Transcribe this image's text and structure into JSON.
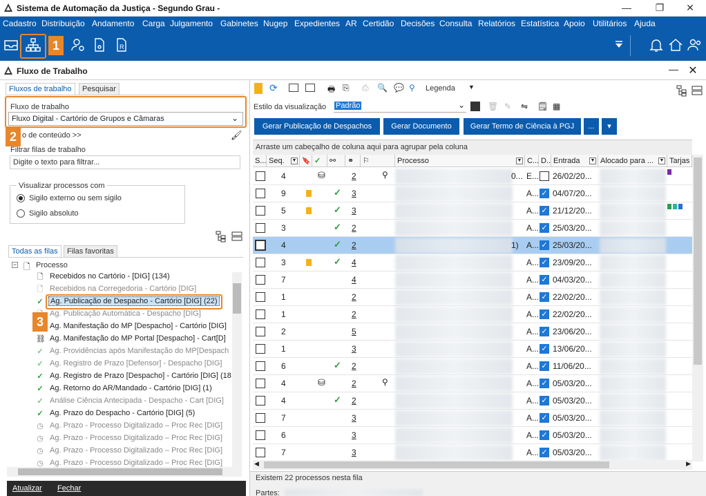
{
  "app": {
    "title": "Sistema de Automação da Justiça - Segundo Grau -",
    "win_min": "—",
    "win_max": "❐",
    "win_close": "✕"
  },
  "menu": [
    "Cadastro",
    "Distribuição",
    "Andamento",
    "Carga",
    "Julgamento",
    "Gabinetes",
    "Nugep",
    "Expedientes",
    "AR",
    "Certidão",
    "Decisões",
    "Consulta",
    "Relatórios",
    "Estatística",
    "Apoio",
    "Utilitários",
    "Ajuda"
  ],
  "callouts": {
    "one": "1",
    "two": "2",
    "three": "3"
  },
  "panel": {
    "title": "Fluxo de Trabalho",
    "close": "✕"
  },
  "left": {
    "tabs": [
      "Fluxos de trabalho",
      "Pesquisar"
    ],
    "flow_label": "Fluxo de trabalho",
    "flow_value": "Fluxo Digital - Cartório de Grupos e Câmaras",
    "content_link": "o de conteúdo >>",
    "filter_label": "Filtrar filas de trabalho",
    "filter_placeholder": "Digite o texto para filtrar...",
    "view_group": "Visualizar processos com",
    "radio1": "Sigilo externo ou sem sigilo",
    "radio2": "Sigilo absoluto",
    "queue_tabs": [
      "Todas as filas",
      "Filas favoritas"
    ],
    "root": "Processo",
    "items": [
      {
        "icon": "doc",
        "text": "Recebidos no Cartório - [DIG] (134)",
        "gray": false
      },
      {
        "icon": "doc",
        "text": "Recebidos na Corregedoria - Cartório [DIG]",
        "gray": true
      },
      {
        "icon": "check",
        "text": "Ag. Publicação de Despacho - Cartório [DIG] (22)",
        "gray": false,
        "sel": true
      },
      {
        "icon": "doc",
        "text": "Ag. Publicação Automática - Despacho [DIG]",
        "gray": true
      },
      {
        "icon": "doc",
        "text": "Ag. Manifestação do MP [Despacho] - Cartório [DIG]",
        "gray": false
      },
      {
        "icon": "share",
        "text": "Ag. Manifestação do MP Portal [Despacho] - Cart[D]",
        "gray": false
      },
      {
        "icon": "check",
        "text": "Ag. Providências após Manifestação do MP[Despach",
        "gray": true
      },
      {
        "icon": "check",
        "text": "Ag. Registro de Prazo [Defensor] - Despacho [DIG]",
        "gray": true
      },
      {
        "icon": "check",
        "text": "Ag. Registro de Prazo [Despacho] - Cartório [DIG] (18",
        "gray": false
      },
      {
        "icon": "check",
        "text": "Ag. Retorno do AR/Mandado - Cartório [DIG] (1)",
        "gray": false
      },
      {
        "icon": "check",
        "text": "Análise Ciência Antecipada - Despacho - Cart [DIG]",
        "gray": true
      },
      {
        "icon": "check",
        "text": "Ag. Prazo do Despacho - Cartório [DIG] (5)",
        "gray": false
      },
      {
        "icon": "clock",
        "text": "Ag. Prazo - Processo Digitalizado – Proc Rec [DIG]",
        "gray": true
      },
      {
        "icon": "clock",
        "text": "Ag. Prazo - Processo Digitalizado – Proc Rec [DIG]",
        "gray": true
      },
      {
        "icon": "clock",
        "text": "Ag. Prazo - Processo Digitalizado – Proc Rec [DIG]",
        "gray": true
      },
      {
        "icon": "clock",
        "text": "Ag. Prazo - Processo Digitalizado – Proc Rec [DIG]",
        "gray": true
      }
    ],
    "footer_update": "Atualizar",
    "footer_close": "Fechar"
  },
  "right": {
    "legend_label": "Legenda",
    "style_label": "Estilo da visualização",
    "style_value": "Padrão",
    "buttons": [
      "Gerar Publicação de Despachos",
      "Gerar Documento",
      "Gerar Termo de Ciência à PGJ",
      "..."
    ],
    "group_hint": "Arraste um cabeçalho de coluna aqui para agrupar pela coluna",
    "columns": [
      "S...",
      "Seq.",
      "",
      "",
      "",
      "",
      "",
      "Processo",
      "C...",
      "D...",
      "Entrada",
      "Alocado para ...",
      "Tarjas"
    ],
    "rows": [
      {
        "seq": "4",
        "flag": false,
        "check": false,
        "doc": true,
        "n": "2",
        "pin": true,
        "c": "E...",
        "d": false,
        "date": "26/02/20...",
        "pre": "0..."
      },
      {
        "seq": "9",
        "flag": true,
        "check": true,
        "doc": false,
        "n": "3",
        "pin": false,
        "c": "A...",
        "d": true,
        "date": "04/07/20..."
      },
      {
        "seq": "5",
        "flag": true,
        "check": true,
        "doc": false,
        "n": "3",
        "pin": false,
        "c": "A...",
        "d": true,
        "date": "21/12/20..."
      },
      {
        "seq": "3",
        "flag": false,
        "check": true,
        "doc": false,
        "n": "2",
        "pin": false,
        "c": "A...",
        "d": true,
        "date": "25/03/20..."
      },
      {
        "seq": "4",
        "flag": false,
        "check": true,
        "doc": false,
        "n": "2",
        "pin": false,
        "c": "A...",
        "d": true,
        "date": "25/03/20...",
        "sel": true,
        "pre": "1)"
      },
      {
        "seq": "3",
        "flag": true,
        "check": true,
        "doc": false,
        "n": "4",
        "pin": false,
        "c": "A...",
        "d": true,
        "date": "23/09/20..."
      },
      {
        "seq": "7",
        "flag": false,
        "check": false,
        "doc": false,
        "n": "4",
        "pin": false,
        "c": "A...",
        "d": true,
        "date": "04/03/20..."
      },
      {
        "seq": "1",
        "flag": false,
        "check": false,
        "doc": false,
        "n": "2",
        "pin": false,
        "c": "A...",
        "d": true,
        "date": "22/02/20..."
      },
      {
        "seq": "1",
        "flag": false,
        "check": false,
        "doc": false,
        "n": "2",
        "pin": false,
        "c": "A...",
        "d": true,
        "date": "22/02/20..."
      },
      {
        "seq": "2",
        "flag": false,
        "check": false,
        "doc": false,
        "n": "5",
        "pin": false,
        "c": "A...",
        "d": true,
        "date": "23/06/20..."
      },
      {
        "seq": "1",
        "flag": false,
        "check": false,
        "doc": false,
        "n": "3",
        "pin": false,
        "c": "A...",
        "d": true,
        "date": "13/06/20..."
      },
      {
        "seq": "6",
        "flag": false,
        "check": true,
        "doc": false,
        "n": "2",
        "pin": false,
        "c": "A...",
        "d": true,
        "date": "11/06/20..."
      },
      {
        "seq": "4",
        "flag": false,
        "check": false,
        "doc": true,
        "n": "2",
        "pin": true,
        "c": "A...",
        "d": true,
        "date": "05/03/20..."
      },
      {
        "seq": "4",
        "flag": false,
        "check": true,
        "doc": false,
        "n": "2",
        "pin": false,
        "c": "A...",
        "d": true,
        "date": "05/03/20..."
      },
      {
        "seq": "7",
        "flag": false,
        "check": false,
        "doc": false,
        "n": "3",
        "pin": false,
        "c": "A...",
        "d": true,
        "date": "05/03/20..."
      },
      {
        "seq": "6",
        "flag": false,
        "check": false,
        "doc": false,
        "n": "3",
        "pin": false,
        "c": "A...",
        "d": true,
        "date": "05/03/20..."
      },
      {
        "seq": "7",
        "flag": false,
        "check": false,
        "doc": false,
        "n": "3",
        "pin": false,
        "c": "A...",
        "d": true,
        "date": "05/03/20..."
      }
    ],
    "status": "Existem 22 processos nesta fila",
    "parts_label": "Partes:"
  },
  "colors": {
    "brand": "#0b5cad",
    "callout": "#e8862a",
    "selected_row": "#a9cdf1"
  }
}
